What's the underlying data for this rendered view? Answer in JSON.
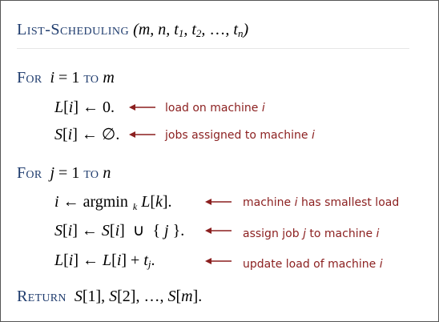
{
  "title": {
    "name": "List-Scheduling",
    "args": "(m, n, t1, t2, …, tn)"
  },
  "lines": {
    "for1_kw": "For",
    "for1_rest": "i = 1 to m",
    "l_init": "L[i] ← 0.",
    "s_init": "S[i] ← ∅.",
    "for2_kw": "For",
    "for2_rest": "j = 1 to n",
    "argmin": "i ← argmin k L[k].",
    "s_update": "S[i] ← S[i] ∪ { j }.",
    "l_update": "L[i] ← L[i] + tj.",
    "return_kw": "Return",
    "return_rest": "S[1], S[2], …, S[m]."
  },
  "notes": {
    "n1": "load on machine i",
    "n2": "jobs assigned to machine i",
    "n3": "machine i has smallest load",
    "n4": "assign job j to machine i",
    "n5": "update load of machine i"
  },
  "colors": {
    "keyword": "#1f3c6e",
    "annotation": "#8b1f1f"
  }
}
